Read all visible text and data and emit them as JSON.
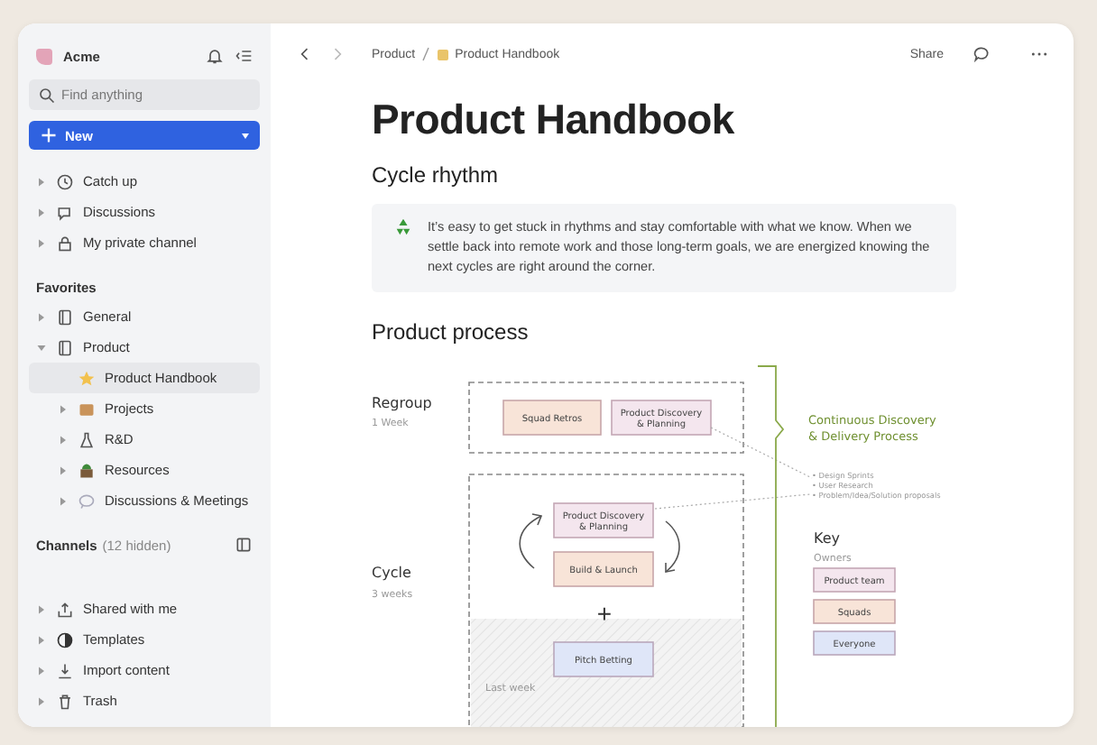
{
  "workspace": {
    "name": "Acme"
  },
  "search": {
    "placeholder": "Find anything"
  },
  "new_button": {
    "label": "New"
  },
  "nav_items": [
    {
      "label": "Catch up",
      "expanded": false
    },
    {
      "label": "Discussions",
      "expanded": false
    },
    {
      "label": "My private channel",
      "expanded": false
    }
  ],
  "favorites": {
    "heading": "Favorites",
    "items": [
      {
        "label": "General",
        "expanded": false,
        "selected": false
      },
      {
        "label": "Product",
        "expanded": true,
        "selected": false,
        "children": [
          {
            "label": "Product Handbook",
            "selected": true
          },
          {
            "label": "Projects",
            "selected": false
          },
          {
            "label": "R&D",
            "selected": false
          },
          {
            "label": "Resources",
            "selected": false
          },
          {
            "label": "Discussions & Meetings",
            "selected": false
          }
        ]
      }
    ]
  },
  "channels": {
    "heading": "Channels",
    "hidden_count": "(12 hidden)"
  },
  "bottom_items": [
    {
      "label": "Shared with me"
    },
    {
      "label": "Templates"
    },
    {
      "label": "Import content"
    },
    {
      "label": "Trash"
    }
  ],
  "breadcrumb": [
    "Product",
    "Product Handbook"
  ],
  "header": {
    "share": "Share"
  },
  "page": {
    "title": "Product Handbook",
    "section_1": "Cycle rhythm",
    "callout": "It’s easy to get stuck in rhythms and stay comfortable with what we know. When we settle back into remote work and those long-term goals, we are energized knowing the next cycles are right around the corner.",
    "section_2": "Product process"
  },
  "diagram": {
    "phases": [
      {
        "label": "Regroup",
        "duration": "1 Week"
      },
      {
        "label": "Cycle",
        "duration": "3 weeks"
      }
    ],
    "regroup_cards": [
      {
        "label": [
          "Squad Retros"
        ],
        "color": "#f8e4d8"
      },
      {
        "label": [
          "Product Discovery",
          "& Planning"
        ],
        "color": "#f4e6ee"
      }
    ],
    "cycle_cards": [
      {
        "label": [
          "Product Discovery",
          "& Planning"
        ],
        "color": "#f4e6ee"
      },
      {
        "label": [
          "Build & Launch"
        ],
        "color": "#f8e4d8"
      }
    ],
    "plus": "+",
    "last_week_card": {
      "label": [
        "Pitch Betting"
      ],
      "color": "#dfe6f8"
    },
    "last_week": "Last week",
    "process_title": [
      "Continuous Discovery",
      "& Delivery Process"
    ],
    "activities": [
      "• Design Sprints",
      "• User Research",
      "• Problem/Idea/Solution proposals"
    ],
    "key": {
      "title": "Key",
      "subtitle": "Owners",
      "items": [
        {
          "label": "Product team",
          "color": "#f4e6ee"
        },
        {
          "label": "Squads",
          "color": "#f8e4d8"
        },
        {
          "label": "Everyone",
          "color": "#dfe6f8"
        }
      ]
    }
  }
}
